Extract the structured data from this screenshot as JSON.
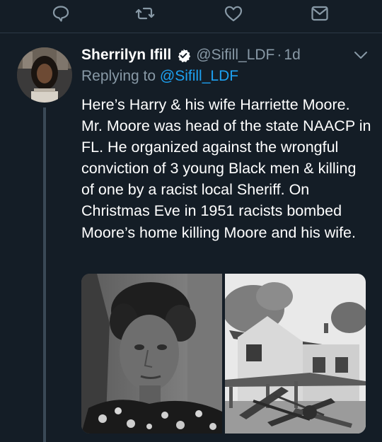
{
  "tweet": {
    "author": {
      "display_name": "Sherrilyn Ifill",
      "handle": "@Sifill_LDF",
      "verified": true,
      "avatar_icon": "profile-photo"
    },
    "separator": "·",
    "time": "1d",
    "replying_to_label": "Replying to",
    "replying_to_handle": "@Sifill_LDF",
    "text": "Here’s Harry & his wife Harriette Moore. Mr. Moore was head of the state NAACP in FL. He organized against the wrongful conviction of 3 young Black men & killing of one by a racist local Sheriff. On Christmas Eve in 1951 racists bombed Moore’s home killing Moore and his wife.",
    "media": [
      {
        "icon": "portrait-photo"
      },
      {
        "icon": "bombed-house-photo"
      }
    ]
  },
  "action_bar": {
    "icons": [
      "reply-icon",
      "retweet-icon",
      "like-icon",
      "message-icon"
    ]
  },
  "colors": {
    "background": "#141d26",
    "primary_text": "#ffffff",
    "secondary_text": "#8899a6",
    "link": "#1da1f2",
    "divider": "#2b3945"
  }
}
